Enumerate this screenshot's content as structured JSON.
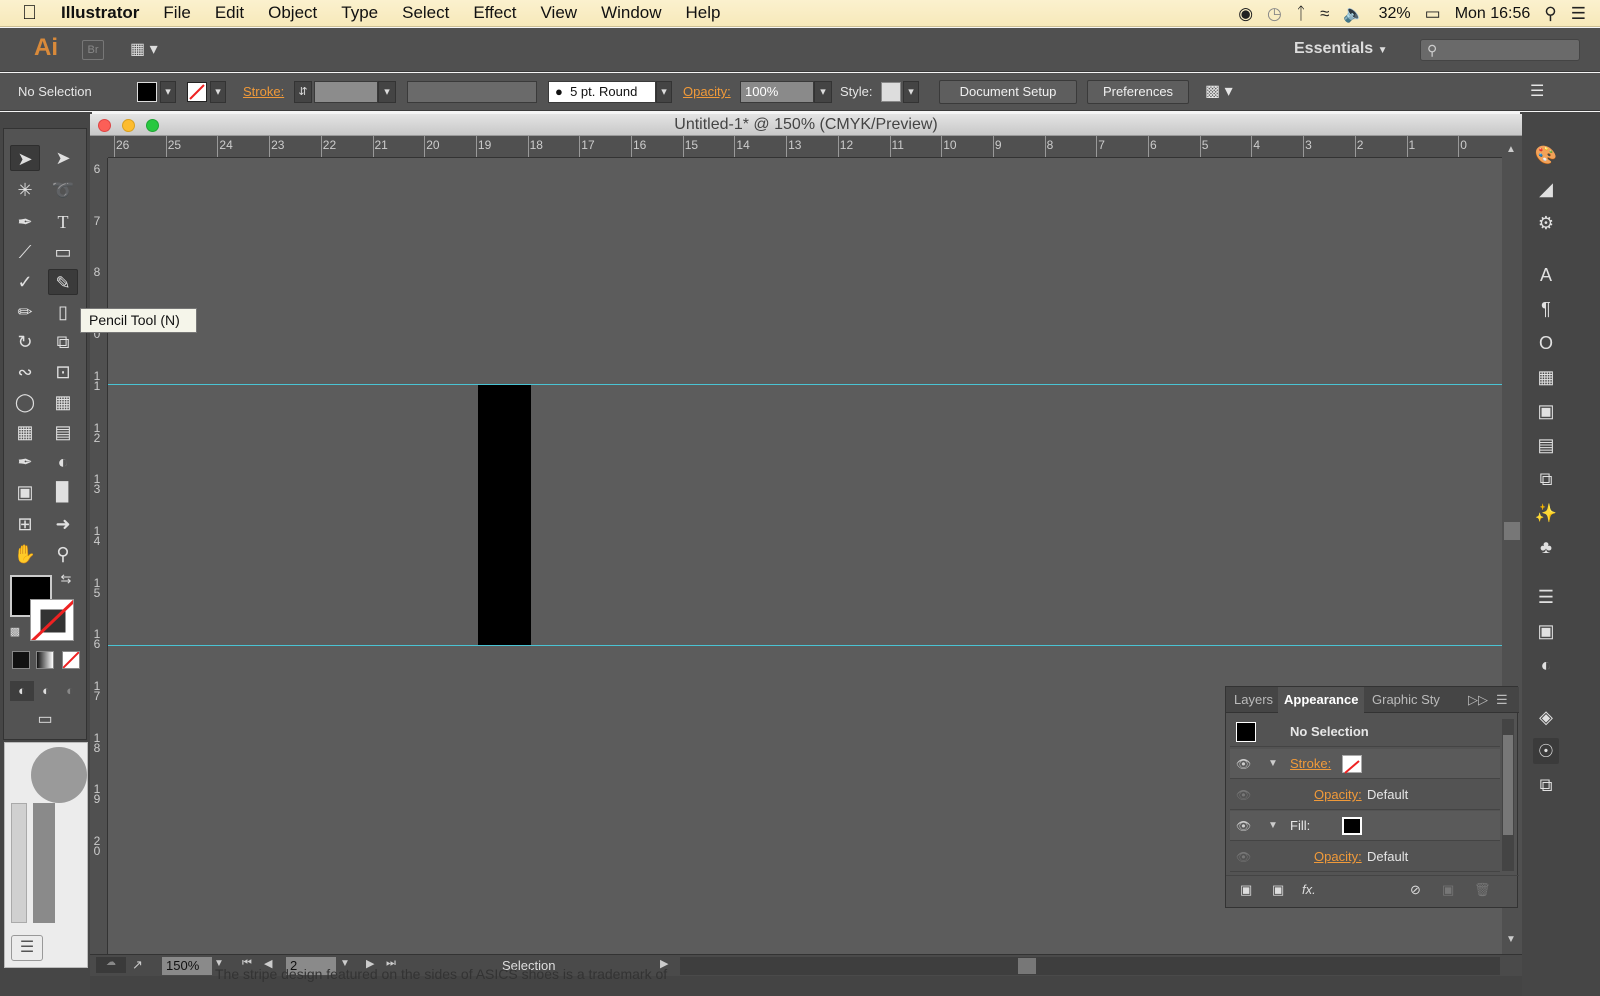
{
  "menubar": {
    "apple": "",
    "app": "Illustrator",
    "items": [
      "File",
      "Edit",
      "Object",
      "Type",
      "Select",
      "Effect",
      "View",
      "Window",
      "Help"
    ],
    "battery": "32%",
    "clock": "Mon 16:56"
  },
  "appbar": {
    "logo": "Ai",
    "bridge": "Br",
    "workspace": "Essentials",
    "search_placeholder": ""
  },
  "control": {
    "selection": "No Selection",
    "stroke_label": "Stroke:",
    "brush": "5 pt. Round",
    "opacity_label": "Opacity:",
    "opacity_value": "100%",
    "style_label": "Style:",
    "doc_setup": "Document Setup",
    "preferences": "Preferences"
  },
  "document": {
    "title": "Untitled-1* @ 150% (CMYK/Preview)",
    "h_ruler": [
      "26",
      "25",
      "24",
      "23",
      "22",
      "21",
      "20",
      "19",
      "18",
      "17",
      "16",
      "15",
      "14",
      "13",
      "12",
      "11",
      "10",
      "9",
      "8",
      "7",
      "6",
      "5",
      "4",
      "3",
      "2",
      "1",
      "0"
    ],
    "v_ruler": [
      "6",
      "7",
      "8",
      "1 0",
      "1 1",
      "1 2",
      "1 3",
      "1 4",
      "1 5",
      "1 6",
      "1 7",
      "1 8",
      "1 9",
      "2 0"
    ],
    "zoom": "150%",
    "artboard": "2",
    "status": "Selection"
  },
  "tooltip": "Pencil Tool (N)",
  "appearance_panel": {
    "tabs": [
      "Layers",
      "Appearance",
      "Graphic Sty"
    ],
    "header": "No Selection",
    "stroke_label": "Stroke:",
    "opacity_label": "Opacity:",
    "opacity_value": "Default",
    "fill_label": "Fill:",
    "fx": "fx."
  },
  "background_text": "The stripe design featured on the sides of ASICS shoes is a trademark of",
  "colors": {
    "guide": "#4ac4d4",
    "accent": "#f09a3a",
    "canvas": "#5c5c5c"
  }
}
